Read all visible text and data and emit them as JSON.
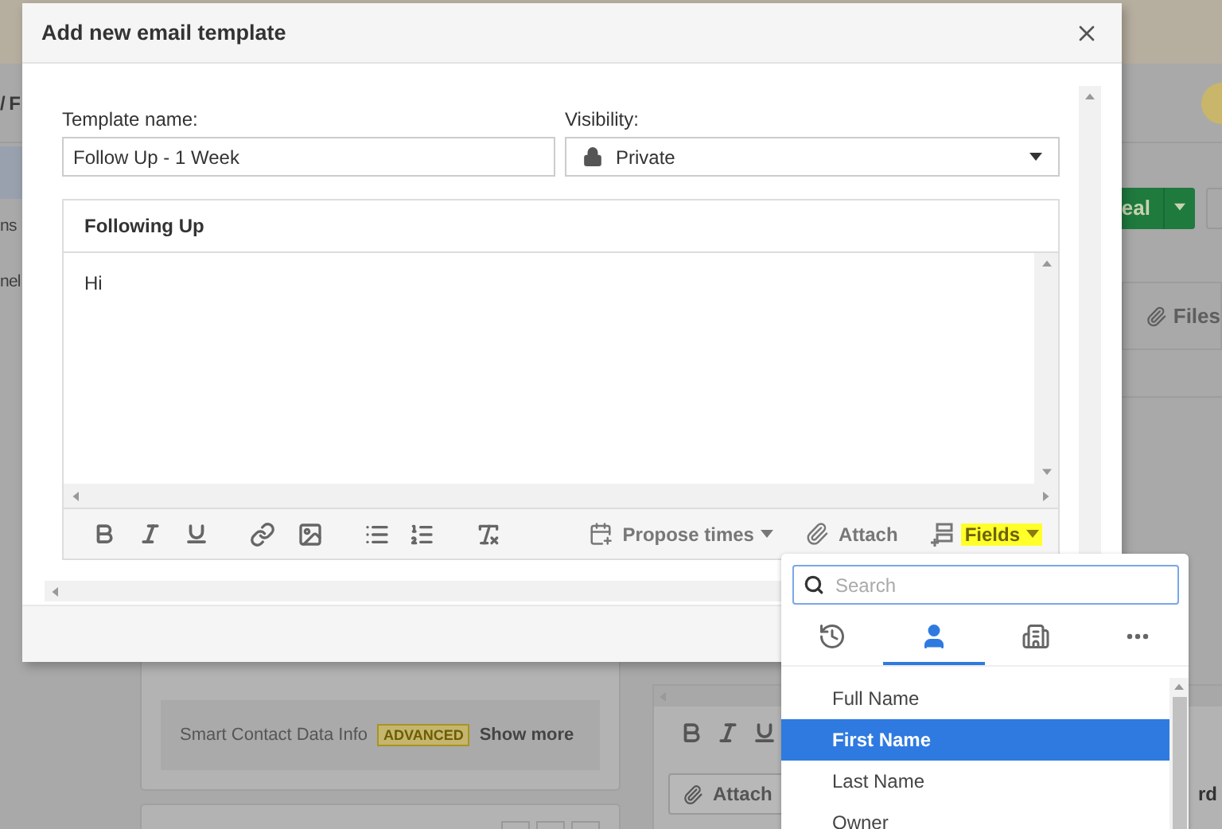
{
  "page": {
    "breadcrumb": "/ F",
    "sidebar_items": [
      "ns",
      "nel"
    ],
    "deal_button": "eal",
    "files_tab": "Files",
    "smart_contact": {
      "label": "Smart Contact Data Info",
      "badge": "ADVANCED",
      "link": "Show more"
    },
    "composer": {
      "attach": "Attach",
      "button_2": "rd"
    }
  },
  "modal": {
    "title": "Add new email template",
    "template_name": {
      "label": "Template name:",
      "value": "Follow Up - 1 Week"
    },
    "visibility": {
      "label": "Visibility:",
      "value": "Private"
    },
    "editor": {
      "subject": "Following Up",
      "body": "Hi",
      "actions": [
        {
          "label": "Propose times",
          "kind": "propose",
          "highlighted": false
        },
        {
          "label": "Attach",
          "kind": "attach",
          "highlighted": false
        },
        {
          "label": "Fields",
          "kind": "fields",
          "highlighted": true
        }
      ]
    }
  },
  "fields_menu": {
    "search": {
      "placeholder": "Search"
    },
    "tabs": [
      {
        "kind": "recent",
        "selected": false
      },
      {
        "kind": "person",
        "selected": true
      },
      {
        "kind": "organization",
        "selected": false
      },
      {
        "kind": "more",
        "selected": false
      }
    ],
    "items": [
      {
        "label": "Full Name",
        "selected": false
      },
      {
        "label": "First Name",
        "selected": true
      },
      {
        "label": "Last Name",
        "selected": false
      },
      {
        "label": "Owner",
        "selected": false
      }
    ]
  }
}
